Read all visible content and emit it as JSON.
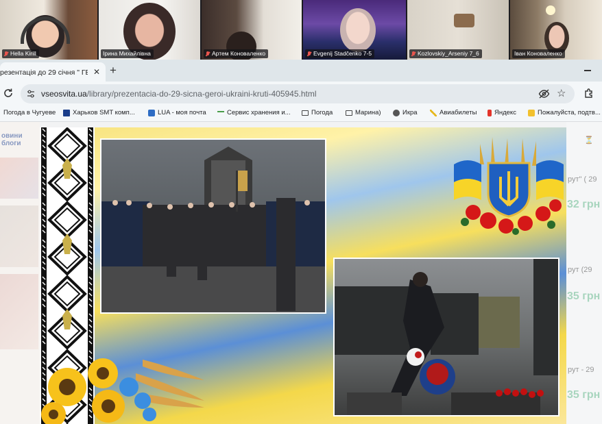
{
  "video_call": {
    "participants": [
      {
        "name": "Hella Kirill",
        "muted": true
      },
      {
        "name": "Ірина Михайлівна",
        "muted": false,
        "speaking": true
      },
      {
        "name": "Артем Коноваленко",
        "muted": true
      },
      {
        "name": "Evgenij Stadčenko 7-5",
        "muted": true
      },
      {
        "name": "Kozlovskiy_Arseniy 7_6",
        "muted": true
      },
      {
        "name": "Іван Коноваленко",
        "muted": false
      }
    ]
  },
  "browser": {
    "tab_title": "резентація до 29 січня \" ГЕР",
    "tab_close": "✕",
    "new_tab": "+",
    "url_domain": "vseosvita.ua",
    "url_path": "/library/prezentacia-do-29-sicna-geroi-ukraini-kruti-405945.html",
    "bookmarks": [
      {
        "label": "Погода в Чугуеве",
        "icon": "weather-icon"
      },
      {
        "label": "Харьков SMT комп...",
        "icon": "smt-icon"
      },
      {
        "label": "LUA - моя почта",
        "icon": "lua-icon"
      },
      {
        "label": "Сервис хранения и...",
        "icon": "storage-icon"
      },
      {
        "label": "Погода",
        "icon": "folder-icon"
      },
      {
        "label": "Марина)",
        "icon": "folder-icon"
      },
      {
        "label": "Икра",
        "icon": "globe-icon"
      },
      {
        "label": "Авиабилеты",
        "icon": "plane-icon"
      },
      {
        "label": "Яндекс",
        "icon": "yandex-icon"
      },
      {
        "label": "Пожалуйста, подтв...",
        "icon": "mail-icon"
      }
    ]
  },
  "page": {
    "left_nav_label": "овини\nблоги",
    "side_items": [
      {
        "label": "рут\" ( 29",
        "price": "32 грн"
      },
      {
        "label": "рут (29",
        "price": "35 грн"
      },
      {
        "label": "рут - 29",
        "price": "35 грн"
      }
    ]
  },
  "colors": {
    "flag_blue": "#1f66c9",
    "flag_yellow": "#f7d428",
    "speaking_outline": "#25c26e",
    "muted_red": "#e8554e"
  }
}
